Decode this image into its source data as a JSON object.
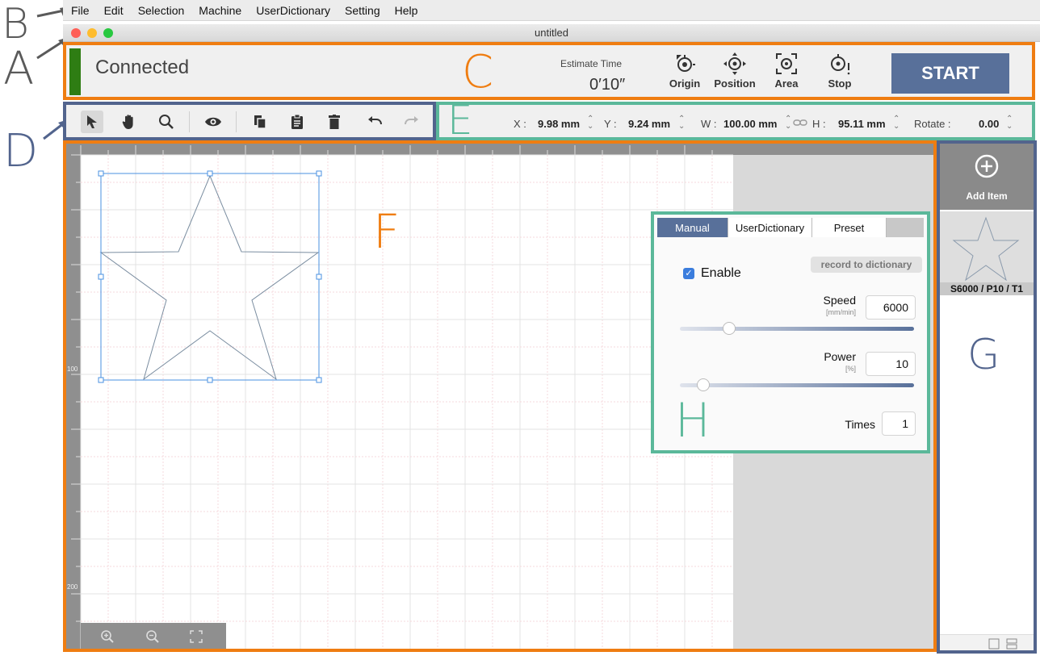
{
  "annotations": {
    "a": "A",
    "b": "B",
    "c": "C",
    "d": "D",
    "e": "E",
    "f": "F",
    "g": "G",
    "h": "H"
  },
  "menu": [
    "File",
    "Edit",
    "Selection",
    "Machine",
    "UserDictionary",
    "Setting",
    "Help"
  ],
  "window": {
    "title": "untitled"
  },
  "status": {
    "text": "Connected",
    "color": "#2e7d13"
  },
  "estimate": {
    "label": "Estimate Time",
    "value": "0′10″"
  },
  "tools": {
    "origin": "Origin",
    "position": "Position",
    "area": "Area",
    "stop": "Stop"
  },
  "start_label": "START",
  "toolbar_icons": [
    "pointer-icon",
    "hand-icon",
    "magnifier-icon",
    "eye-icon",
    "copy-icon",
    "paste-icon",
    "trash-icon",
    "undo-icon",
    "redo-icon"
  ],
  "props": {
    "x_label": "X :",
    "x_value": "9.98 mm",
    "y_label": "Y :",
    "y_value": "9.24 mm",
    "w_label": "W :",
    "w_value": "100.00 mm",
    "h_label": "H :",
    "h_value": "95.11 mm",
    "rotate_label": "Rotate :",
    "rotate_value": "0.00"
  },
  "ruler": {
    "mark_100": "100",
    "mark_200": "200"
  },
  "panel": {
    "tabs": [
      "Manual",
      "UserDictionary",
      "Preset"
    ],
    "active_tab": "Manual",
    "record_label": "record to dictionary",
    "enable_label": "Enable",
    "enable_checked": true,
    "speed_label": "Speed",
    "speed_unit": "[mm/min]",
    "speed_value": "6000",
    "speed_slider_fraction": 0.21,
    "power_label": "Power",
    "power_unit": "[%]",
    "power_value": "10",
    "power_slider_fraction": 0.1,
    "times_label": "Times",
    "times_value": "1"
  },
  "items": {
    "add_label": "Add Item",
    "item_label": "S6000 / P10 / T1"
  },
  "colors": {
    "orange": "#ef7d11",
    "blue": "#52648d",
    "green": "#5bb89a",
    "accent": "#58709a"
  }
}
